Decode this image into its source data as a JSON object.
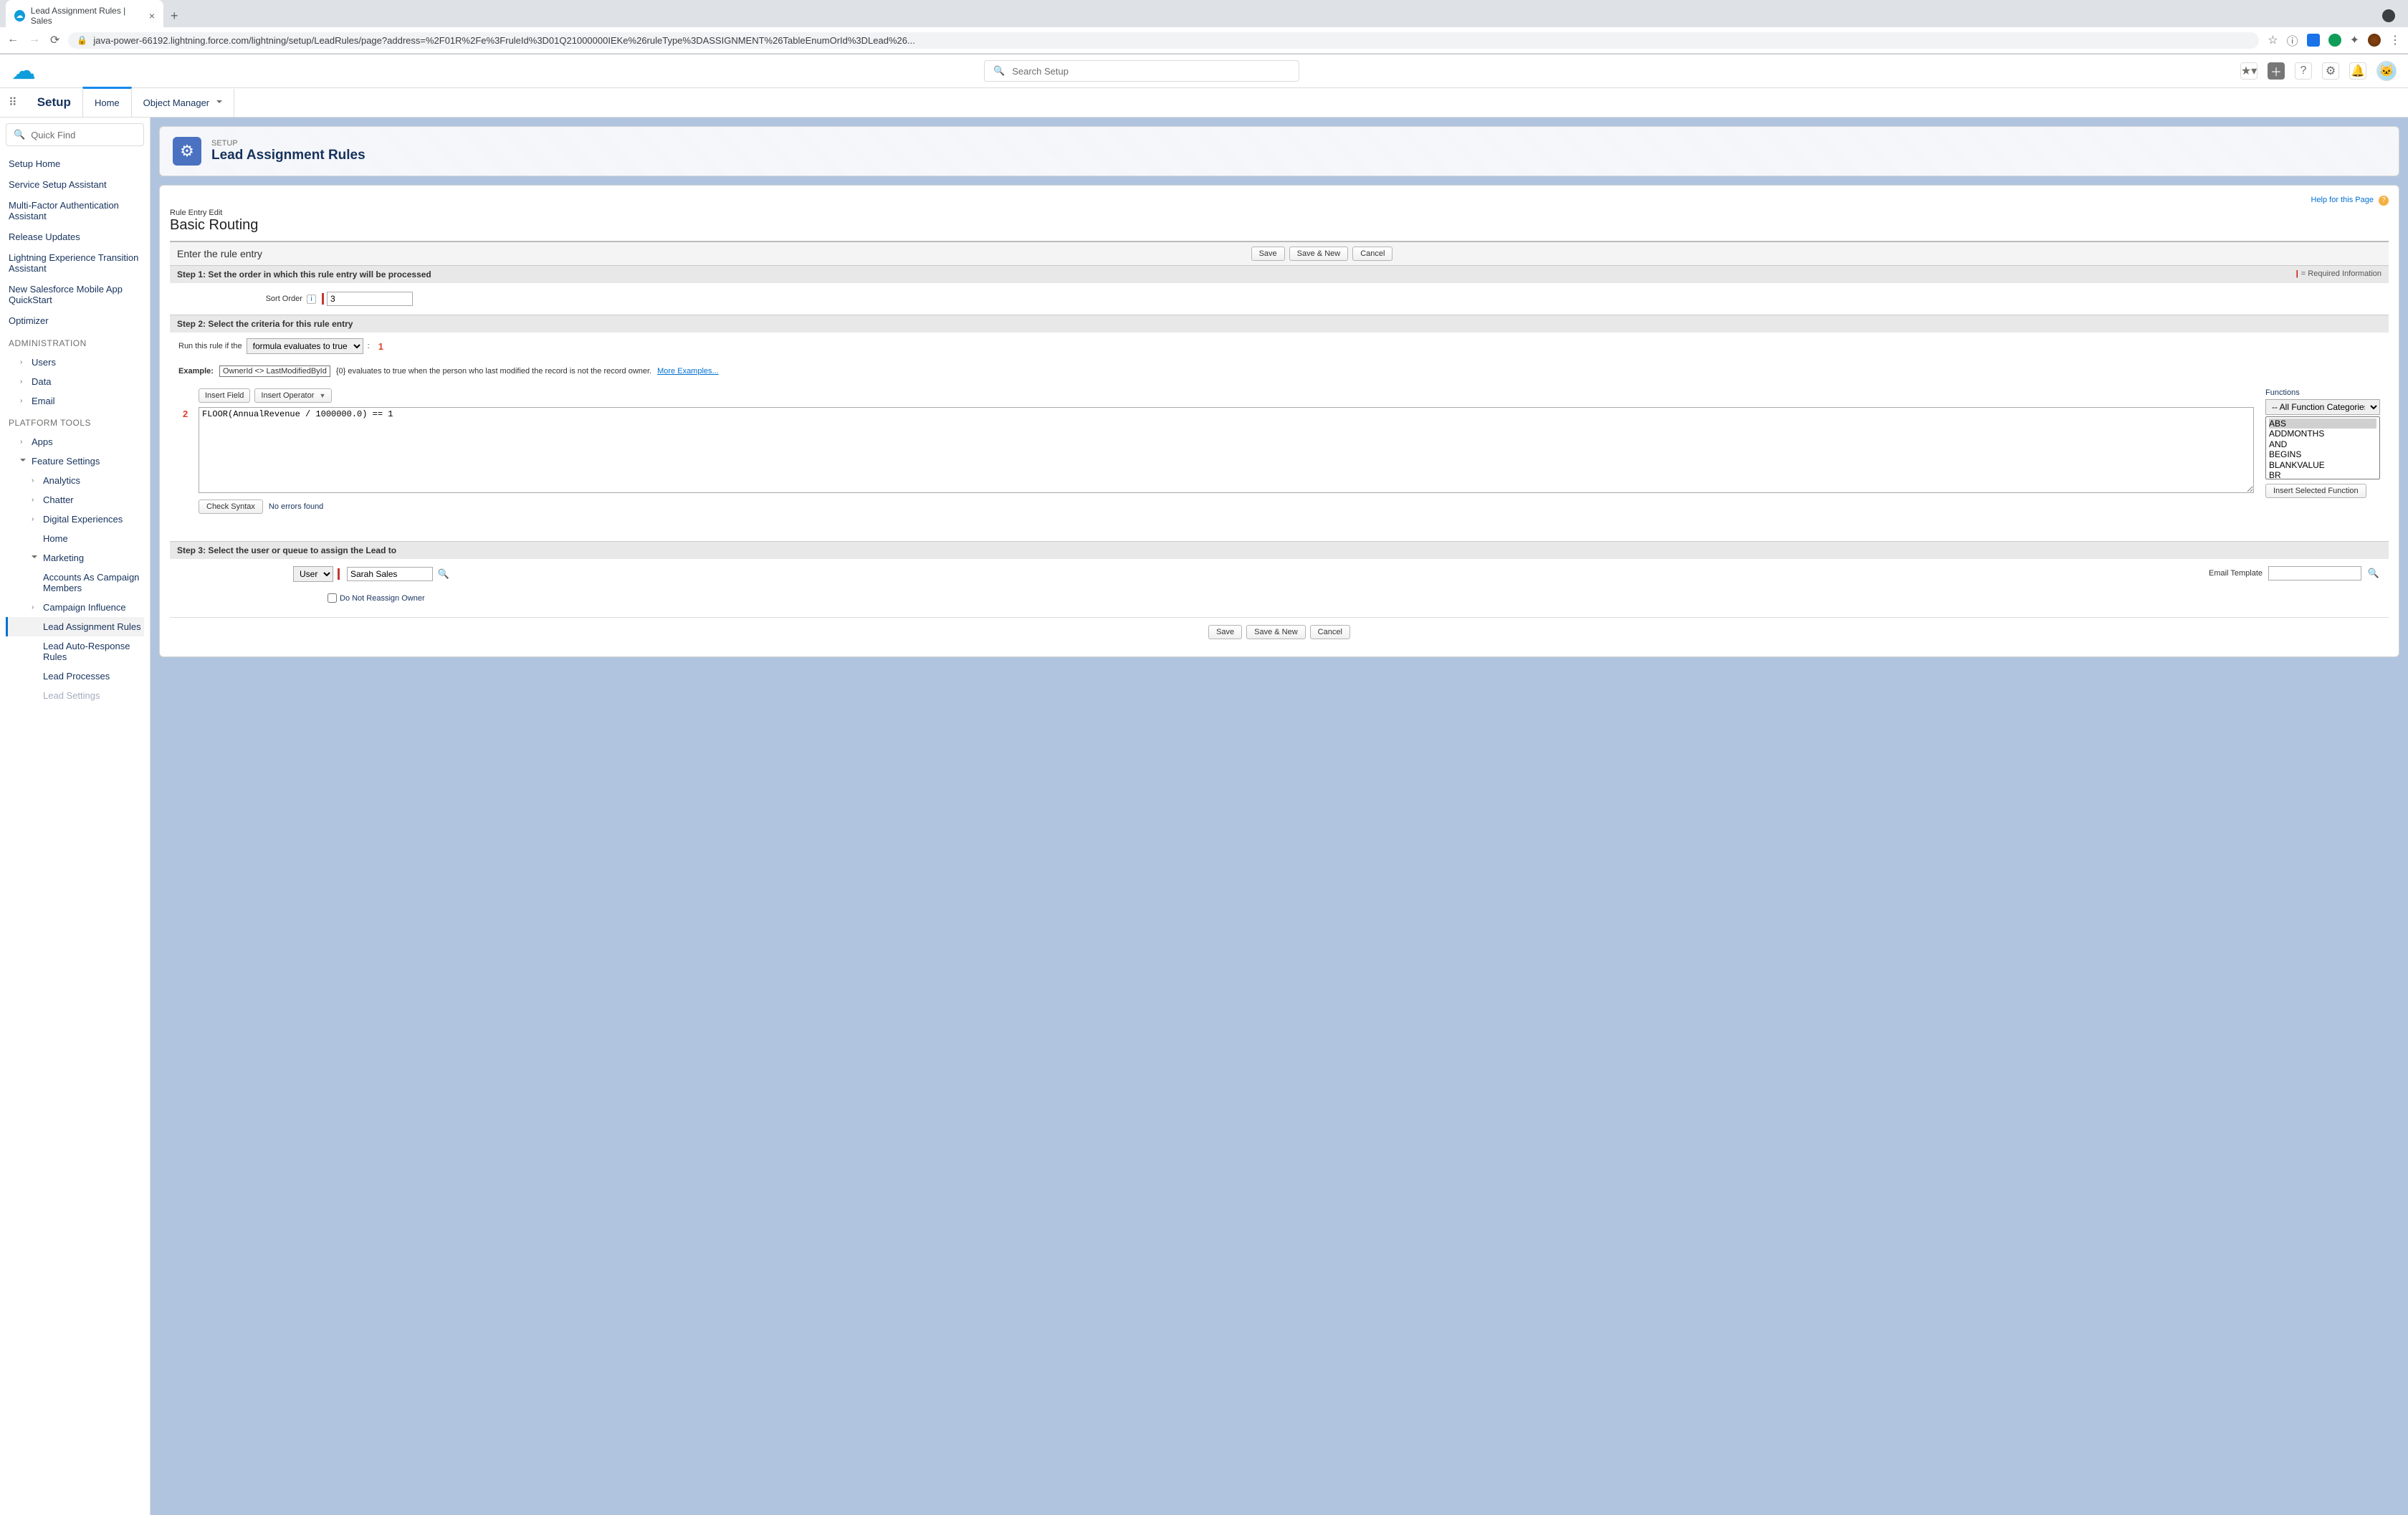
{
  "browser": {
    "tab_title": "Lead Assignment Rules | Sales",
    "url": "java-power-66192.lightning.force.com/lightning/setup/LeadRules/page?address=%2F01R%2Fe%3FruleId%3D01Q21000000IEKe%26ruleType%3DASSIGNMENT%26TableEnumOrId%3DLead%26..."
  },
  "sf_header": {
    "search_placeholder": "Search Setup"
  },
  "context": {
    "setup": "Setup",
    "home": "Home",
    "object_manager": "Object Manager"
  },
  "sidebar": {
    "quick_find": "Quick Find",
    "items": [
      "Setup Home",
      "Service Setup Assistant",
      "Multi-Factor Authentication Assistant",
      "Release Updates",
      "Lightning Experience Transition Assistant",
      "New Salesforce Mobile App QuickStart",
      "Optimizer"
    ],
    "administration_heading": "ADMINISTRATION",
    "admin_items": [
      "Users",
      "Data",
      "Email"
    ],
    "platform_heading": "PLATFORM TOOLS",
    "apps": "Apps",
    "feature_settings": "Feature Settings",
    "feature_children": [
      "Analytics",
      "Chatter",
      "Digital Experiences",
      "Home",
      "Marketing"
    ],
    "marketing_children": [
      "Accounts As Campaign Members",
      "Campaign Influence",
      "Lead Assignment Rules",
      "Lead Auto-Response Rules",
      "Lead Processes",
      "Lead Settings"
    ]
  },
  "page": {
    "eyebrow": "SETUP",
    "title": "Lead Assignment Rules",
    "help_link": "Help for this Page",
    "rule_entry_edit": "Rule Entry Edit",
    "rule_name": "Basic Routing",
    "enter_rule": "Enter the rule entry",
    "save": "Save",
    "save_new": "Save & New",
    "cancel": "Cancel",
    "step1": "Step 1: Set the order in which this rule entry will be processed",
    "required": "= Required Information",
    "sort_order_label": "Sort Order",
    "sort_order_value": "3",
    "step2": "Step 2: Select the criteria for this rule entry",
    "run_rule_if": "Run this rule if the",
    "criteria_option": "formula evaluates to true",
    "callout1": "1",
    "example_label": "Example:",
    "example_code": "OwnerId <> LastModifiedById",
    "example_text": "{0} evaluates to true when the person who last modified the record is not the record owner.",
    "more_examples": "More Examples...",
    "insert_field": "Insert Field",
    "insert_operator": "Insert Operator",
    "callout2": "2",
    "formula": "FLOOR(AnnualRevenue / 1000000.0) == 1",
    "functions_label": "Functions",
    "functions_category": "-- All Function Categories --",
    "functions": [
      "ABS",
      "ADDMONTHS",
      "AND",
      "BEGINS",
      "BLANKVALUE",
      "BR"
    ],
    "insert_selected": "Insert Selected Function",
    "check_syntax": "Check Syntax",
    "no_errors": "No errors found",
    "step3": "Step 3: Select the user or queue to assign the Lead to",
    "assignee_type": "User",
    "assignee_value": "Sarah Sales",
    "do_not_reassign": "Do Not Reassign Owner",
    "email_template_label": "Email Template"
  }
}
